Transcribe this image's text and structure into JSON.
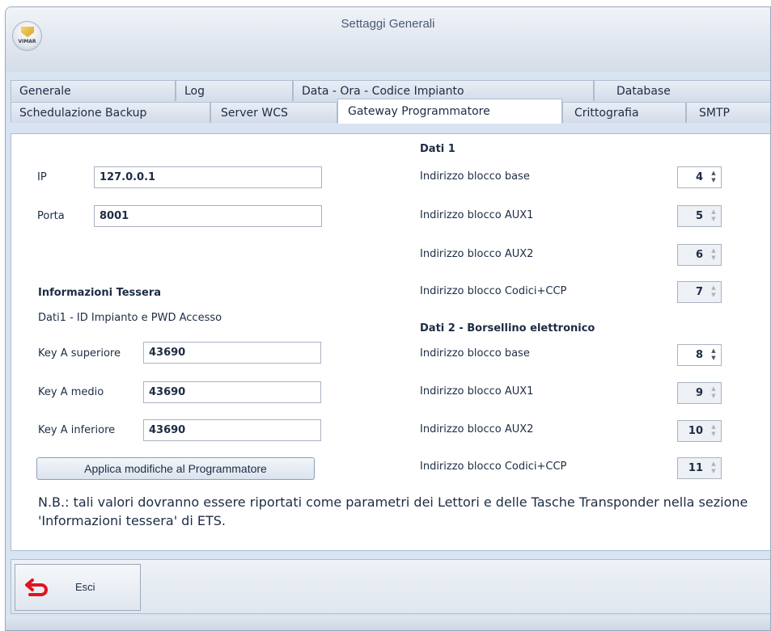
{
  "window": {
    "title": "Settaggi Generali",
    "logo_text": "VIMAR"
  },
  "tabs_row1": [
    {
      "label": "Generale"
    },
    {
      "label": "Log"
    },
    {
      "label": "Data - Ora - Codice Impianto"
    },
    {
      "label": "Database"
    }
  ],
  "tabs_row2": [
    {
      "label": "Schedulazione Backup"
    },
    {
      "label": "Server WCS"
    },
    {
      "label": "Gateway Programmatore"
    },
    {
      "label": "Crittografia"
    },
    {
      "label": "SMTP"
    }
  ],
  "active_tab": "Gateway Programmatore",
  "connection": {
    "ip_label": "IP",
    "ip_value": "127.0.0.1",
    "port_label": "Porta",
    "port_value": "8001"
  },
  "card_info": {
    "heading": "Informazioni Tessera",
    "subheading": "Dati1 - ID Impianto e PWD Accesso",
    "keys": [
      {
        "label": "Key A superiore",
        "value": "43690"
      },
      {
        "label": "Key A medio",
        "value": "43690"
      },
      {
        "label": "Key A inferiore",
        "value": "43690"
      }
    ]
  },
  "dati1": {
    "heading": "Dati 1",
    "rows": [
      {
        "label": "Indirizzo blocco base",
        "value": "4",
        "enabled": true
      },
      {
        "label": "Indirizzo blocco AUX1",
        "value": "5",
        "enabled": false
      },
      {
        "label": "Indirizzo blocco AUX2",
        "value": "6",
        "enabled": false
      },
      {
        "label": "Indirizzo blocco Codici+CCP",
        "value": "7",
        "enabled": false
      }
    ]
  },
  "dati2": {
    "heading": "Dati 2 - Borsellino elettronico",
    "rows": [
      {
        "label": "Indirizzo blocco base",
        "value": "8",
        "enabled": true
      },
      {
        "label": "Indirizzo blocco AUX1",
        "value": "9",
        "enabled": false
      },
      {
        "label": "Indirizzo blocco AUX2",
        "value": "10",
        "enabled": false
      },
      {
        "label": "Indirizzo blocco Codici+CCP",
        "value": "11",
        "enabled": false
      }
    ]
  },
  "apply_button": "Applica modifiche al Programmatore",
  "note": "N.B.: tali valori dovranno essere riportati come parametri dei Lettori e delle Tasche Transponder nella sezione 'Informazioni tessera' di ETS.",
  "exit_button": {
    "label": "Esci",
    "icon": "undo-arrow-icon"
  },
  "colors": {
    "window_bg": "#d9e4f2",
    "panel_bg": "#ffffff",
    "text": "#1d2c44",
    "exit_icon": "#e0141e"
  }
}
